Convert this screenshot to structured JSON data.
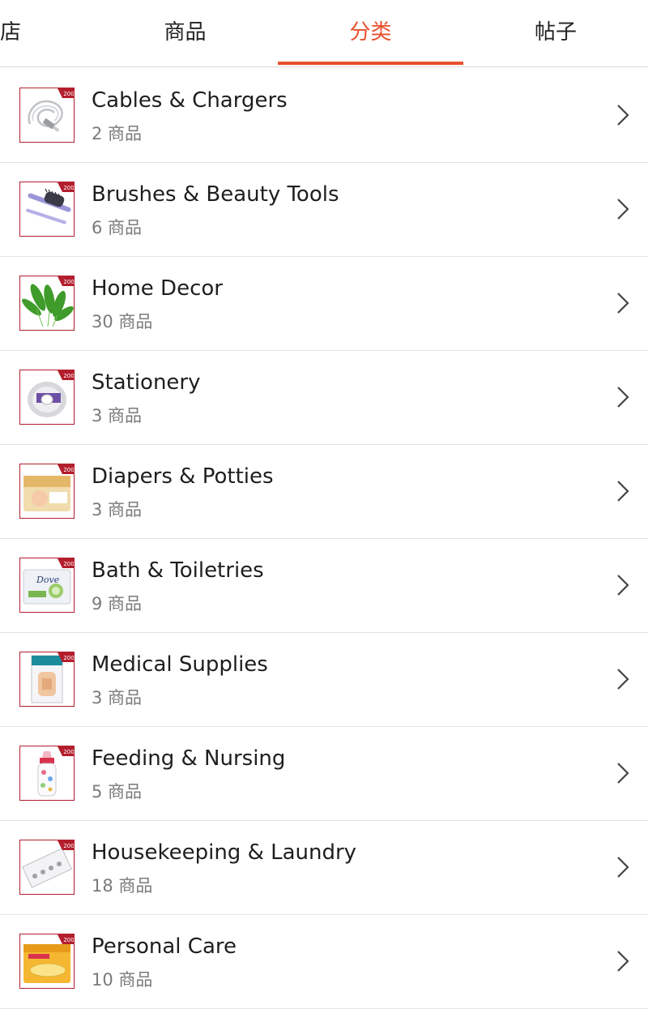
{
  "tabs": {
    "shop": "店",
    "products": "商品",
    "categories": "分类",
    "posts": "帖子",
    "active": "categories",
    "accent_color": "#e8502e"
  },
  "categories": [
    {
      "name": "Cables & Chargers",
      "count": "2 商品",
      "icon": "usb-cable-icon"
    },
    {
      "name": "Brushes & Beauty Tools",
      "count": "6 商品",
      "icon": "hair-brush-icon"
    },
    {
      "name": "Home Decor",
      "count": "30 商品",
      "icon": "leaf-decor-icon"
    },
    {
      "name": "Stationery",
      "count": "3 商品",
      "icon": "tape-roll-icon"
    },
    {
      "name": "Diapers & Potties",
      "count": "3 商品",
      "icon": "diaper-pack-icon"
    },
    {
      "name": "Bath & Toiletries",
      "count": "9 商品",
      "icon": "soap-bar-icon"
    },
    {
      "name": "Medical Supplies",
      "count": "3 商品",
      "icon": "bandage-pack-icon"
    },
    {
      "name": "Feeding & Nursing",
      "count": "5 商品",
      "icon": "baby-bottle-icon"
    },
    {
      "name": "Housekeeping & Laundry",
      "count": "18 商品",
      "icon": "hooks-pack-icon"
    },
    {
      "name": "Personal Care",
      "count": "10 商品",
      "icon": "pads-pack-icon"
    }
  ],
  "thumb_badge": "200",
  "colors": {
    "thumb_border": "#b31e2d",
    "badge": "#b31e2d",
    "divider": "#e4e4e4",
    "secondary_text": "#7a7a7a"
  }
}
